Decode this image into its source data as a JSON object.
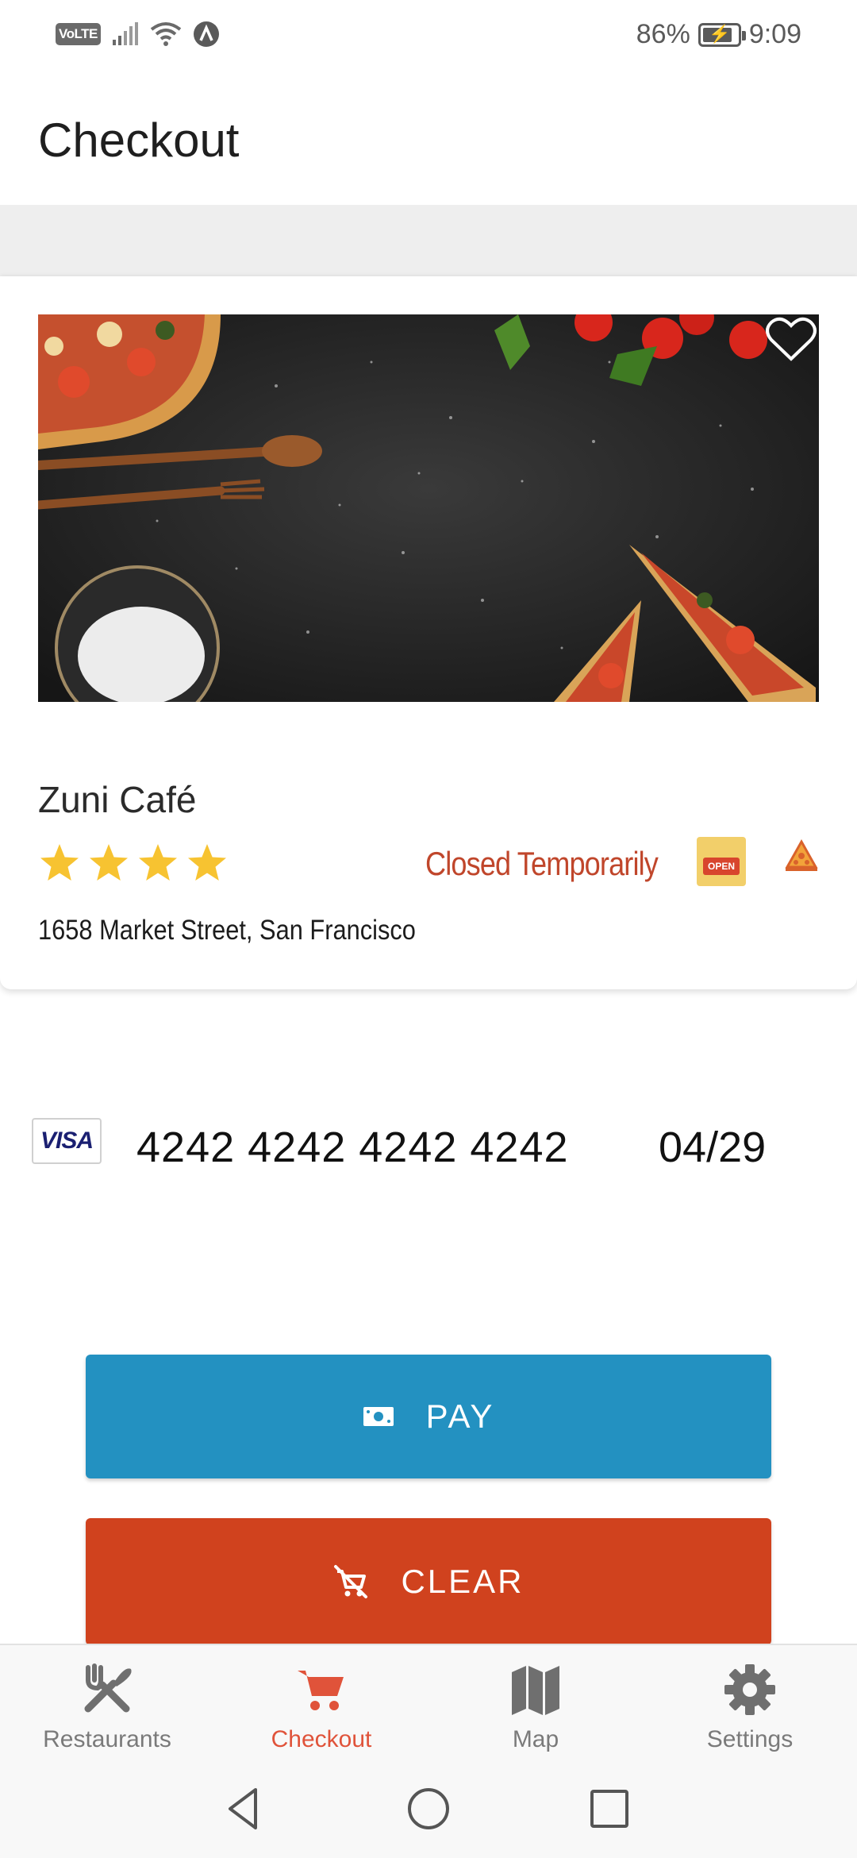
{
  "status_bar": {
    "volte": "VoLTE",
    "battery_percent": "86%",
    "battery_level": 0.86,
    "time": "9:09",
    "icons": [
      "signal-icon",
      "wifi-icon",
      "app-notification-icon",
      "battery-charging-icon"
    ]
  },
  "header": {
    "title": "Checkout"
  },
  "restaurant": {
    "name": "Zuni Café",
    "rating": 4,
    "rating_max": 4,
    "status": "Closed Temporarily",
    "open_badge": "OPEN",
    "address": "1658 Market Street, San Francisco",
    "star_color": "#f7c331",
    "status_color": "#c0462b"
  },
  "payment": {
    "brand": "VISA",
    "card_number": "4242 4242 4242 4242",
    "expiry": "04/29"
  },
  "actions": {
    "pay_label": "PAY",
    "clear_label": "CLEAR",
    "pay_color": "#2391c1",
    "clear_color": "#d0421e"
  },
  "bottom_nav": {
    "items": [
      {
        "label": "Restaurants",
        "icon": "utensils-icon",
        "active": false
      },
      {
        "label": "Checkout",
        "icon": "cart-icon",
        "active": true
      },
      {
        "label": "Map",
        "icon": "map-icon",
        "active": false
      },
      {
        "label": "Settings",
        "icon": "gear-icon",
        "active": false
      }
    ],
    "active_color": "#e0533a",
    "inactive_color": "#7a7a7a"
  },
  "system_nav": {
    "icons": [
      "back-icon",
      "home-icon",
      "recents-icon"
    ]
  }
}
